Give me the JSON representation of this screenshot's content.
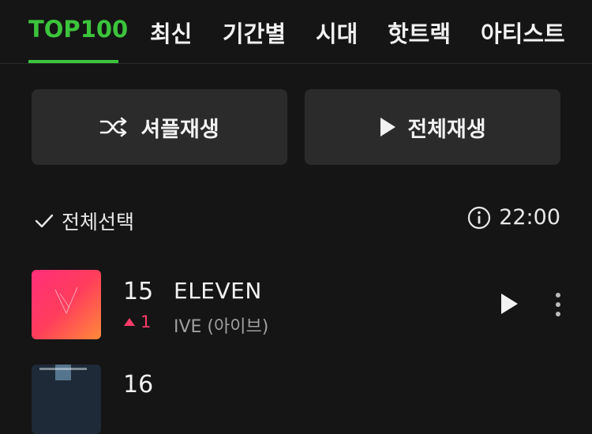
{
  "tabs": [
    {
      "label": "TOP100",
      "active": true
    },
    {
      "label": "최신"
    },
    {
      "label": "기간별"
    },
    {
      "label": "시대"
    },
    {
      "label": "핫트랙"
    },
    {
      "label": "아티스트"
    }
  ],
  "buttons": {
    "shuffle_label": "셔플재생",
    "play_all_label": "전체재생"
  },
  "list_header": {
    "select_all_label": "전체선택",
    "total_duration": "22:00"
  },
  "songs": [
    {
      "rank": "15",
      "change": "1",
      "change_direction": "up",
      "title": "ELEVEN",
      "artist": "IVE (아이브)"
    },
    {
      "rank": "16",
      "change": "",
      "change_direction": "",
      "title": "",
      "artist": ""
    }
  ],
  "colors": {
    "accent": "#3cc43c",
    "background": "#151515",
    "button_bg": "#2b2b2b",
    "rank_up": "#ff3b6b"
  },
  "icons": {
    "shuffle": "shuffle-icon",
    "play": "play-icon",
    "check": "check-icon",
    "info": "info-icon",
    "more": "more-vertical-icon"
  }
}
